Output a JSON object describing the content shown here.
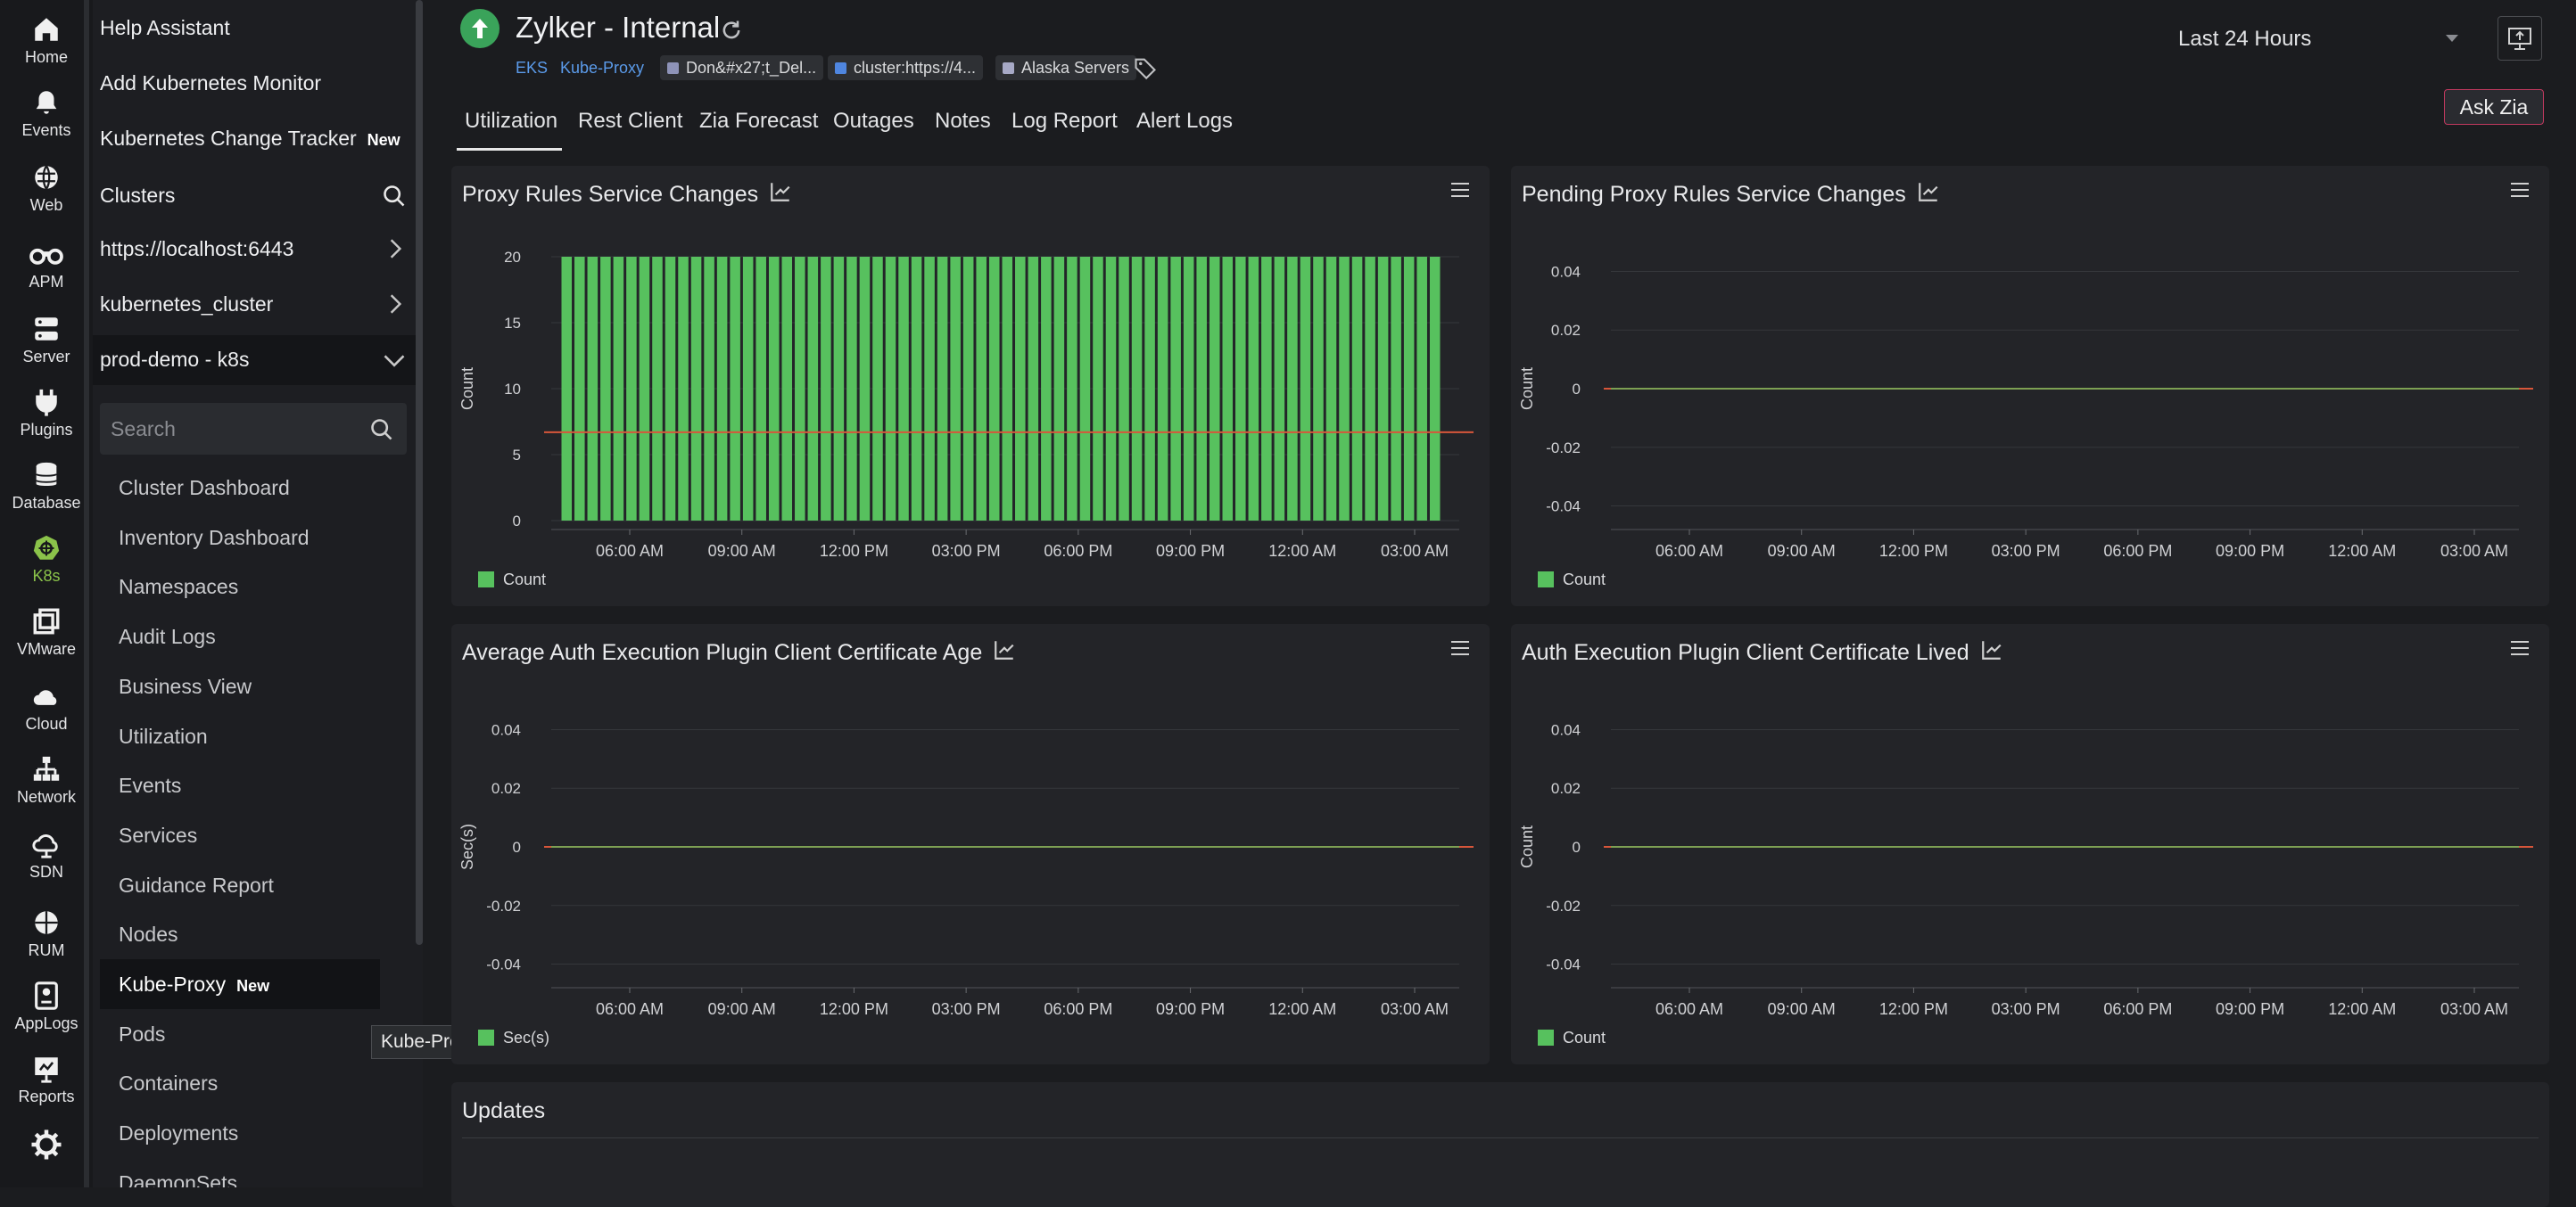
{
  "rail": [
    {
      "label": "Home",
      "icon": "home-icon"
    },
    {
      "label": "Events",
      "icon": "bell-icon"
    },
    {
      "label": "Web",
      "icon": "globe-icon"
    },
    {
      "label": "APM",
      "icon": "binoculars-icon"
    },
    {
      "label": "Server",
      "icon": "server-icon"
    },
    {
      "label": "Plugins",
      "icon": "plug-icon"
    },
    {
      "label": "Database",
      "icon": "database-icon"
    },
    {
      "label": "K8s",
      "icon": "kubernetes-icon"
    },
    {
      "label": "VMware",
      "icon": "vmware-icon"
    },
    {
      "label": "Cloud",
      "icon": "cloud-icon"
    },
    {
      "label": "Network",
      "icon": "network-icon"
    },
    {
      "label": "SDN",
      "icon": "sdn-icon"
    },
    {
      "label": "RUM",
      "icon": "rum-icon"
    },
    {
      "label": "AppLogs",
      "icon": "applogs-icon"
    },
    {
      "label": "Reports",
      "icon": "reports-icon"
    }
  ],
  "nav": {
    "help": "Help Assistant",
    "add_monitor": "Add Kubernetes Monitor",
    "change_tracker": "Kubernetes Change Tracker",
    "new_badge": "New",
    "clusters_heading": "Clusters",
    "clusters": [
      "https://localhost:6443",
      "kubernetes_cluster",
      "prod-demo - k8s"
    ],
    "search_placeholder": "Search",
    "items": [
      "Cluster Dashboard",
      "Inventory Dashboard",
      "Namespaces",
      "Audit Logs",
      "Business View",
      "Utilization",
      "Events",
      "Services",
      "Guidance Report",
      "Nodes",
      "Kube-Proxy",
      "Pods",
      "Containers",
      "Deployments",
      "DaemonSets"
    ],
    "active_item_index": 10,
    "tooltip": "Kube-Proxy"
  },
  "header": {
    "monitor_name": "Zylker - Internal",
    "tags": [
      "EKS",
      "Kube-Proxy"
    ],
    "chips": [
      {
        "label": "Don&#x27;t_Del...",
        "color": "#8e93b8"
      },
      {
        "label": "cluster:https://4...",
        "color": "#4f86e0"
      },
      {
        "label": "Alaska Servers",
        "color": "#a7a9c6"
      }
    ],
    "time_range": "Last 24 Hours",
    "tabs": [
      "Utilization",
      "Rest Client",
      "Zia Forecast",
      "Outages",
      "Notes",
      "Log Report",
      "Alert Logs"
    ],
    "active_tab": 0,
    "ask_zia": "Ask Zia"
  },
  "colors": {
    "series": "#57c15e",
    "threshold": "#d7563a",
    "accent": "#8bc34a"
  },
  "panels": [
    {
      "title": "Proxy Rules Service Changes"
    },
    {
      "title": "Pending Proxy Rules Service Changes"
    },
    {
      "title": "Average Auth Execution Plugin Client Certificate Age"
    },
    {
      "title": "Auth Execution Plugin Client Certificate Lived"
    }
  ],
  "updates_title": "Updates",
  "chart_data": [
    {
      "type": "bar",
      "title": "Proxy Rules Service Changes",
      "ylabel": "Count",
      "yticks": [
        "0",
        "5",
        "10",
        "15",
        "20"
      ],
      "ylim": [
        0,
        20
      ],
      "xticks": [
        "06:00 AM",
        "09:00 AM",
        "12:00 PM",
        "03:00 PM",
        "06:00 PM",
        "09:00 PM",
        "12:00 AM",
        "03:00 AM"
      ],
      "series": [
        {
          "name": "Count",
          "pattern": "alternating 20 and 0 across the 24 hour window"
        }
      ],
      "threshold": 6.7,
      "legend": "Count"
    },
    {
      "type": "line",
      "title": "Pending Proxy Rules Service Changes",
      "ylabel": "Count",
      "yticks": [
        "0.04",
        "0.02",
        "0",
        "-0.02",
        "-0.04"
      ],
      "ylim": [
        -0.045,
        0.045
      ],
      "xticks": [
        "06:00 AM",
        "09:00 AM",
        "12:00 PM",
        "03:00 PM",
        "06:00 PM",
        "09:00 PM",
        "12:00 AM",
        "03:00 AM"
      ],
      "series": [
        {
          "name": "Count",
          "values": [
            0,
            0,
            0,
            0,
            0,
            0,
            0,
            0
          ]
        }
      ],
      "legend": "Count"
    },
    {
      "type": "line",
      "title": "Average Auth Execution Plugin Client Certificate Age",
      "ylabel": "Sec(s)",
      "yticks": [
        "0.04",
        "0.02",
        "0",
        "-0.02",
        "-0.04"
      ],
      "ylim": [
        -0.045,
        0.045
      ],
      "xticks": [
        "06:00 AM",
        "09:00 AM",
        "12:00 PM",
        "03:00 PM",
        "06:00 PM",
        "09:00 PM",
        "12:00 AM",
        "03:00 AM"
      ],
      "series": [
        {
          "name": "Sec(s)",
          "values": [
            0,
            0,
            0,
            0,
            0,
            0,
            0,
            0
          ]
        }
      ],
      "legend": "Sec(s)"
    },
    {
      "type": "line",
      "title": "Auth Execution Plugin Client Certificate Lived",
      "ylabel": "Count",
      "yticks": [
        "0.04",
        "0.02",
        "0",
        "-0.02",
        "-0.04"
      ],
      "ylim": [
        -0.045,
        0.045
      ],
      "xticks": [
        "06:00 AM",
        "09:00 AM",
        "12:00 PM",
        "03:00 PM",
        "06:00 PM",
        "09:00 PM",
        "12:00 AM",
        "03:00 AM"
      ],
      "series": [
        {
          "name": "Count",
          "values": [
            0,
            0,
            0,
            0,
            0,
            0,
            0,
            0
          ]
        }
      ],
      "legend": "Count"
    }
  ]
}
